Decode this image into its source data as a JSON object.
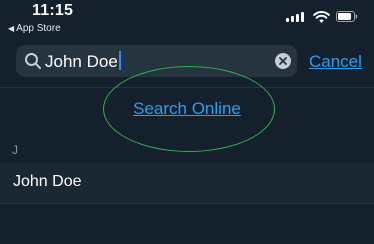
{
  "status_bar": {
    "time": "11:15",
    "back_app": "App Store",
    "icons": [
      "cellular-signal-icon",
      "wifi-icon",
      "battery-icon"
    ]
  },
  "search": {
    "value": "John Doe",
    "cancel_label": "Cancel"
  },
  "search_online": {
    "label": "Search Online"
  },
  "results": {
    "section_header": "J",
    "items": [
      {
        "name": "John Doe"
      }
    ]
  },
  "colors": {
    "background": "#14202b",
    "accent": "#2a9df4",
    "highlight": "#2db34a"
  }
}
